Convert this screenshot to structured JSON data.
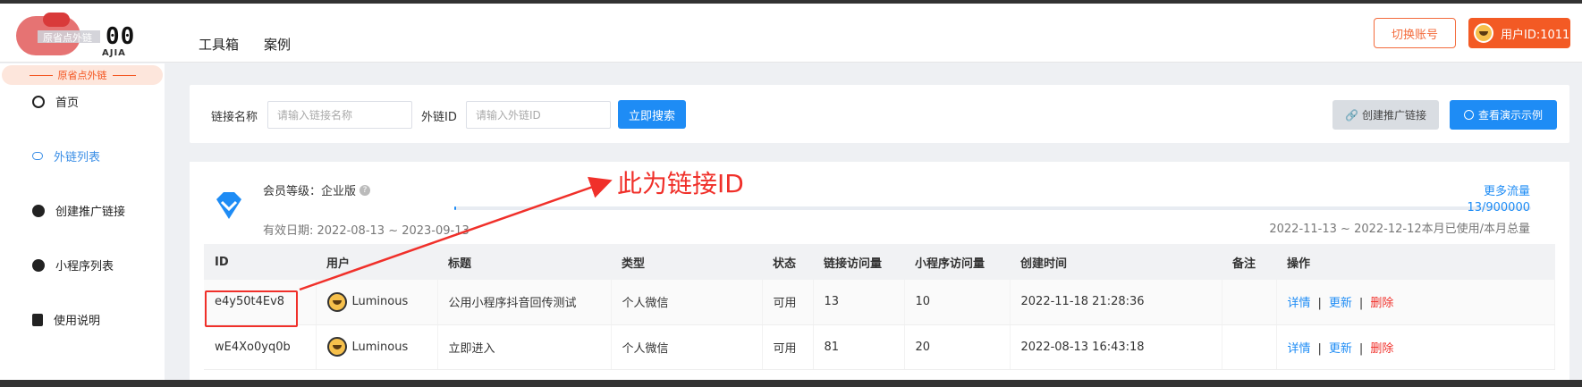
{
  "header": {
    "logo_blur_text": "原省点外链",
    "logo_big": "00",
    "logo_sub": "AJIA",
    "nav": [
      "工具箱",
      "案例"
    ],
    "switch_account": "切换账号",
    "user_id": "用户ID:1011"
  },
  "sidebar": {
    "banner": "原省点外链",
    "items": [
      {
        "label": "首页",
        "icon": "home-icon"
      },
      {
        "label": "外链列表",
        "icon": "link-icon",
        "active": true
      },
      {
        "label": "创建推广链接",
        "icon": "plus-circle-icon"
      },
      {
        "label": "小程序列表",
        "icon": "miniapp-icon"
      },
      {
        "label": "使用说明",
        "icon": "doc-icon"
      }
    ]
  },
  "search": {
    "name_label": "链接名称",
    "name_placeholder": "请输入链接名称",
    "id_label": "外链ID",
    "id_placeholder": "请输入外链ID",
    "search_button": "立即搜索",
    "create_button": "创建推广链接",
    "demo_button": "查看演示示例"
  },
  "membership": {
    "level_label": "会员等级：企业版",
    "valid_label": "有效日期:  2022-08-13 ~ 2023-09-13",
    "more_traffic": "更多流量",
    "usage": "13/900000",
    "usage_fraction": 1.44e-05,
    "usage_range": "2022-11-13 ~ 2022-12-12本月已使用/本月总量"
  },
  "annotation": "此为链接ID",
  "table": {
    "columns": [
      "ID",
      "用户",
      "标题",
      "类型",
      "状态",
      "链接访问量",
      "小程序访问量",
      "创建时间",
      "备注",
      "操作"
    ],
    "rows": [
      {
        "id": "e4y50t4Ev8",
        "user": "Luminous",
        "title": "公用小程序抖音回传测试",
        "type": "个人微信",
        "status": "可用",
        "link_visits": "13",
        "mini_visits": "10",
        "created": "2022-11-18 21:28:36",
        "note": ""
      },
      {
        "id": "wE4Xo0yq0b",
        "user": "Luminous",
        "title": "立即进入",
        "type": "个人微信",
        "status": "可用",
        "link_visits": "81",
        "mini_visits": "20",
        "created": "2022-08-13 16:43:18",
        "note": ""
      }
    ],
    "actions": {
      "detail": "详情",
      "update": "更新",
      "delete": "删除"
    }
  },
  "colors": {
    "accent": "#1e8cf5",
    "brand": "#f35a24",
    "ok": "#2dbd4f",
    "danger": "#f0302a"
  }
}
